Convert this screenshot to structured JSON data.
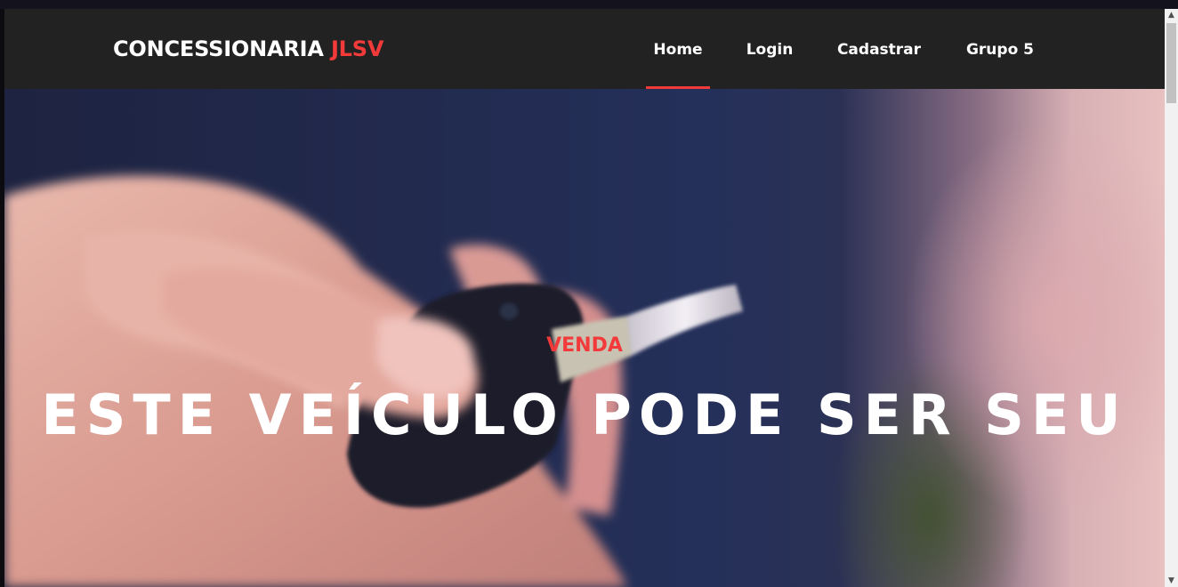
{
  "navbar": {
    "brand_main": "CONCESSIONARIA",
    "brand_accent": "JLSV",
    "items": [
      {
        "label": "Home",
        "active": true
      },
      {
        "label": "Login",
        "active": false
      },
      {
        "label": "Cadastrar",
        "active": false
      },
      {
        "label": "Grupo 5",
        "active": false
      }
    ]
  },
  "hero": {
    "tag": "VENDA",
    "title": "ESTE VEÍCULO PODE SER SEU"
  },
  "colors": {
    "accent": "#f23a3a",
    "navbar_bg": "#222222",
    "text": "#ffffff"
  },
  "scrollbar": {
    "up_icon": "chevron-up-icon",
    "down_icon": "chevron-down-icon"
  }
}
